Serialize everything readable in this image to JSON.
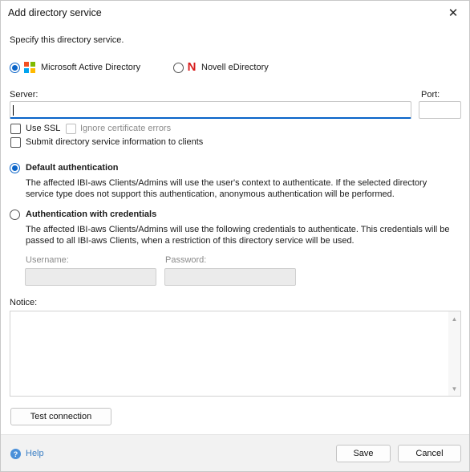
{
  "dialog": {
    "title": "Add directory service",
    "close_glyph": "✕"
  },
  "intro": "Specify this directory service.",
  "service_type": {
    "options": [
      {
        "label": "Microsoft Active Directory",
        "icon": "microsoft-icon",
        "selected": true
      },
      {
        "label": "Novell eDirectory",
        "icon": "novell-icon",
        "selected": false
      }
    ],
    "novell_glyph": "N"
  },
  "server": {
    "label": "Server:",
    "value": ""
  },
  "port": {
    "label": "Port:",
    "value": ""
  },
  "use_ssl": {
    "label": "Use SSL",
    "checked": false
  },
  "ignore_cert": {
    "label": "Ignore certificate errors",
    "checked": false,
    "enabled": false
  },
  "submit_info": {
    "label": "Submit directory service information to clients",
    "checked": false
  },
  "auth": {
    "default": {
      "label": "Default authentication",
      "selected": true,
      "description": "The affected IBI-aws Clients/Admins will use the user's context to authenticate. If the selected directory service type does not support this authentication, anonymous authentication will be performed."
    },
    "credentials": {
      "label": "Authentication with credentials",
      "selected": false,
      "description": "The affected IBI-aws Clients/Admins will use the following credentials to authenticate. This credentials will be passed to all IBI-aws Clients, when a restriction of this directory service will be used."
    },
    "username": {
      "label": "Username:",
      "value": ""
    },
    "password": {
      "label": "Password:",
      "value": ""
    }
  },
  "notice": {
    "label": "Notice:",
    "value": ""
  },
  "test_connection_label": "Test connection",
  "footer": {
    "help_label": "Help",
    "help_glyph": "?",
    "save_label": "Save",
    "cancel_label": "Cancel"
  },
  "colors": {
    "accent": "#0a64c8",
    "link": "#3b7fc4",
    "ms_red": "#f25022",
    "ms_green": "#7fba00",
    "ms_blue": "#00a4ef",
    "ms_yellow": "#ffb900",
    "novell_red": "#d81e1e"
  }
}
